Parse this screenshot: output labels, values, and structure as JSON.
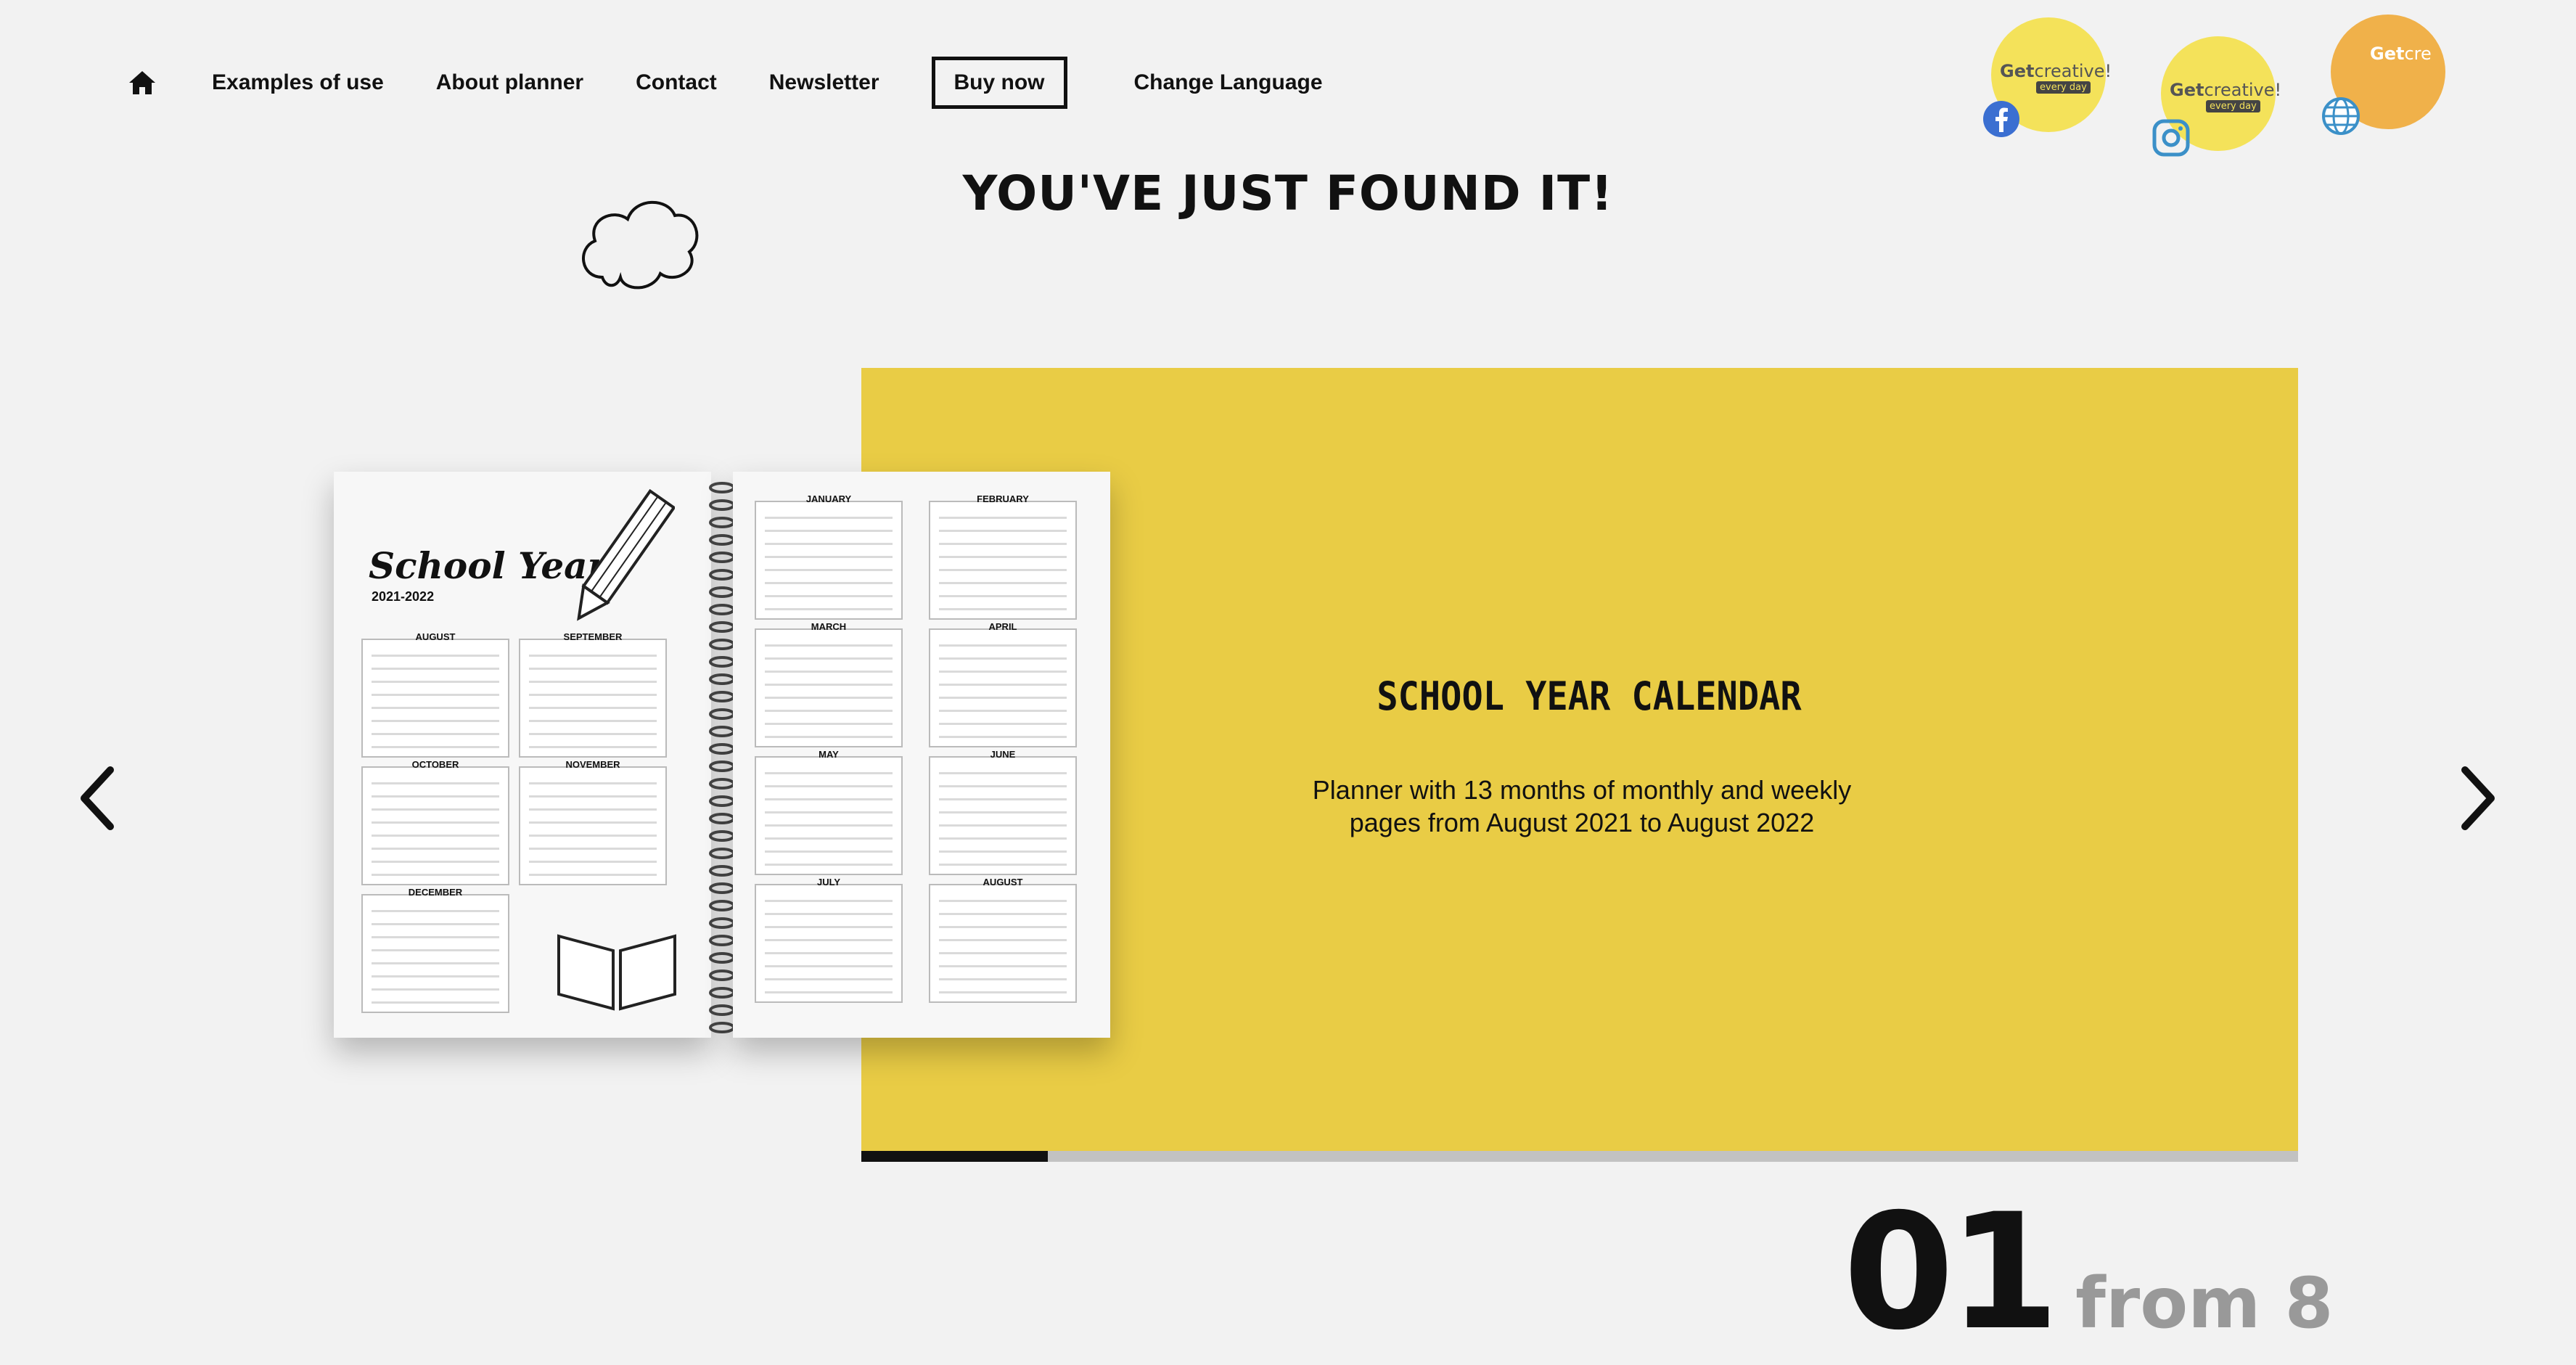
{
  "nav": {
    "items": [
      "Examples of use",
      "About planner",
      "Contact",
      "Newsletter"
    ],
    "buy_label": "Buy now",
    "language_label": "Change Language"
  },
  "social": [
    {
      "name": "facebook",
      "brand": "Get",
      "brand2": "creative!",
      "sub": "every day",
      "icon": "facebook-icon"
    },
    {
      "name": "instagram",
      "brand": "Get",
      "brand2": "creative!",
      "sub": "every day",
      "icon": "instagram-icon"
    },
    {
      "name": "website",
      "brand": "Get",
      "brand2": "cre",
      "sub": "",
      "icon": "globe-icon"
    }
  ],
  "headline": "YOU'VE JUST FOUND IT!",
  "slide": {
    "title": "SCHOOL YEAR CALENDAR",
    "description": "Planner with 13 months of monthly and weekly pages from August 2021 to August 2022",
    "book": {
      "title": "School Year",
      "years": "2021-2022",
      "left_months": [
        "AUGUST",
        "SEPTEMBER",
        "OCTOBER",
        "NOVEMBER",
        "DECEMBER"
      ],
      "right_months": [
        "JANUARY",
        "FEBRUARY",
        "MARCH",
        "APRIL",
        "MAY",
        "JUNE",
        "JULY",
        "AUGUST"
      ]
    }
  },
  "counter": {
    "current": "01",
    "total_label": "from 8"
  },
  "progress": 0.13,
  "colors": {
    "panel": "#e9cc45",
    "background": "#f2f2f2",
    "text": "#111111"
  }
}
